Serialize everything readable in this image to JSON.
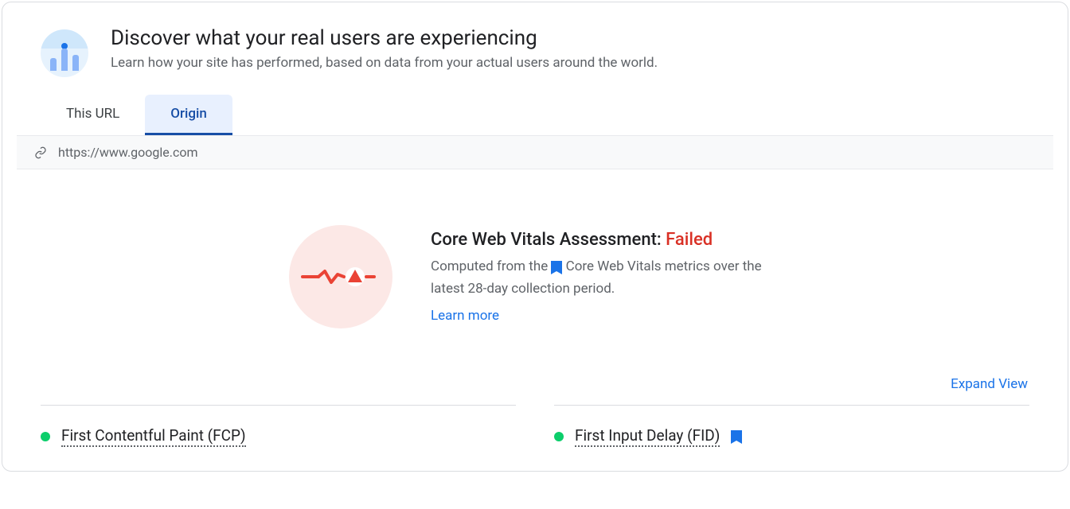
{
  "header": {
    "title": "Discover what your real users are experiencing",
    "subtitle": "Learn how your site has performed, based on data from your actual users around the world."
  },
  "tabs": {
    "items": [
      "This URL",
      "Origin"
    ],
    "active_index": 1
  },
  "urlbar": {
    "url": "https://www.google.com"
  },
  "assessment": {
    "title_prefix": "Core Web Vitals Assessment: ",
    "status_label": "Failed",
    "status": "failed",
    "description_1": "Computed from the ",
    "description_2": " Core Web Vitals metrics over the latest 28-day collection period.",
    "learn_more": "Learn more"
  },
  "actions": {
    "expand_view": "Expand View"
  },
  "metrics": [
    {
      "name": "First Contentful Paint (FCP)",
      "status": "good",
      "core": false
    },
    {
      "name": "First Input Delay (FID)",
      "status": "good",
      "core": true
    }
  ]
}
